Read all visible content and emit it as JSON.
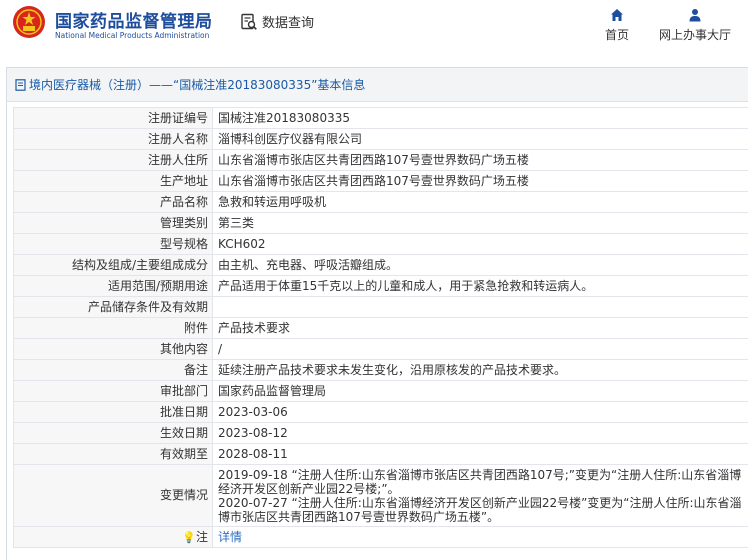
{
  "header": {
    "site_name_cn": "国家药品监督管理局",
    "site_name_en": "National Medical Products Administration",
    "data_query_label": "数据查询",
    "nav": {
      "home_label": "首页",
      "online_service_label": "网上办事大厅"
    }
  },
  "breadcrumb": {
    "text": "境内医疗器械（注册）——“国械注准20183080335”基本信息"
  },
  "fields": [
    {
      "label": "注册证编号",
      "value": "国械注准20183080335"
    },
    {
      "label": "注册人名称",
      "value": "淄博科创医疗仪器有限公司"
    },
    {
      "label": "注册人住所",
      "value": "山东省淄博市张店区共青团西路107号壹世界数码广场五楼"
    },
    {
      "label": "生产地址",
      "value": "山东省淄博市张店区共青团西路107号壹世界数码广场五楼"
    },
    {
      "label": "产品名称",
      "value": "急救和转运用呼吸机"
    },
    {
      "label": "管理类别",
      "value": "第三类"
    },
    {
      "label": "型号规格",
      "value": "KCH602"
    },
    {
      "label": "结构及组成/主要组成成分",
      "value": "由主机、充电器、呼吸活瓣组成。"
    },
    {
      "label": "适用范围/预期用途",
      "value": "产品适用于体重15千克以上的儿童和成人，用于紧急抢救和转运病人。"
    },
    {
      "label": "产品储存条件及有效期",
      "value": ""
    },
    {
      "label": "附件",
      "value": "产品技术要求"
    },
    {
      "label": "其他内容",
      "value": "/"
    },
    {
      "label": "备注",
      "value": "延续注册产品技术要求未发生变化，沿用原核发的产品技术要求。"
    },
    {
      "label": "审批部门",
      "value": "国家药品监督管理局"
    },
    {
      "label": "批准日期",
      "value": "2023-03-06"
    },
    {
      "label": "生效日期",
      "value": "2023-08-12"
    },
    {
      "label": "有效期至",
      "value": "2028-08-11"
    }
  ],
  "change_history": {
    "label": "变更情况",
    "entries": [
      "2019-09-18  “注册人住所:山东省淄博市张店区共青团西路107号;”变更为“注册人住所:山东省淄博经济开发区创新产业园22号楼;”。",
      "2020-07-27  “注册人住所:山东省淄博经济开发区创新产业园22号楼”变更为“注册人住所:山东省淄博市张店区共青团西路107号壹世界数码广场五楼”。"
    ]
  },
  "note": {
    "label": "注",
    "link_label": "详情"
  },
  "colors": {
    "brand_blue": "#1e4d9e",
    "link_blue": "#2f6fc4",
    "label_bg": "#f7f7f7",
    "logo_red": "#d7261c"
  }
}
